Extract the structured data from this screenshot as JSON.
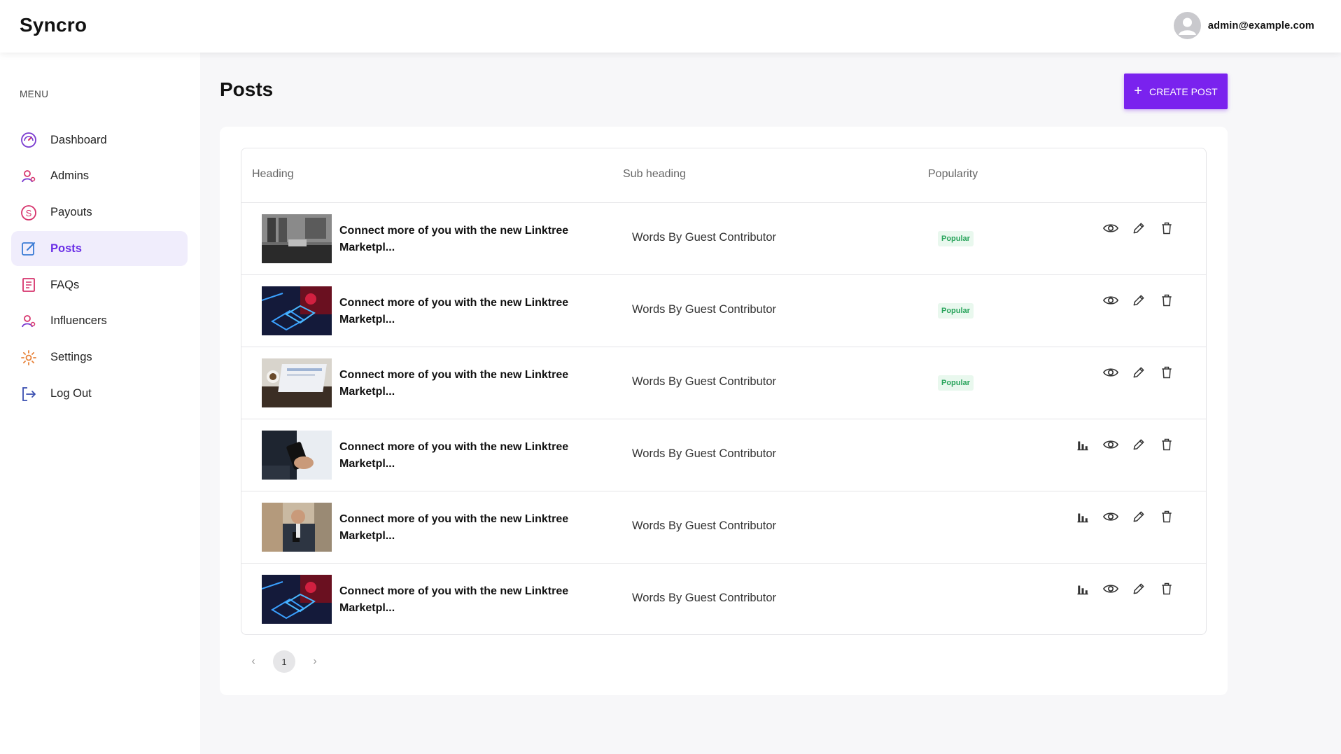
{
  "app": {
    "name": "Syncro"
  },
  "user": {
    "email": "admin@example.com"
  },
  "sidebar": {
    "menu_title": "MENU",
    "items": [
      {
        "label": "Dashboard",
        "icon": "dashboard-icon",
        "active": false
      },
      {
        "label": "Admins",
        "icon": "admins-icon",
        "active": false
      },
      {
        "label": "Payouts",
        "icon": "payouts-icon",
        "active": false
      },
      {
        "label": "Posts",
        "icon": "posts-icon",
        "active": true
      },
      {
        "label": "FAQs",
        "icon": "faqs-icon",
        "active": false
      },
      {
        "label": "Influencers",
        "icon": "influencers-icon",
        "active": false
      },
      {
        "label": "Settings",
        "icon": "settings-icon",
        "active": false
      },
      {
        "label": "Log Out",
        "icon": "logout-icon",
        "active": false
      }
    ]
  },
  "page": {
    "title": "Posts",
    "create_button": "CREATE POST"
  },
  "table": {
    "columns": [
      "Heading",
      "Sub heading",
      "Popularity"
    ],
    "rows": [
      {
        "heading": "Connect more of you with the new Linktree Marketpl...",
        "sub_heading": "Words By Guest Contributor",
        "popularity": "Popular",
        "thumbnail": "office-desk"
      },
      {
        "heading": "Connect more of you with the new Linktree Marketpl...",
        "sub_heading": "Words By Guest Contributor",
        "popularity": "Popular",
        "thumbnail": "neon-gaming"
      },
      {
        "heading": "Connect more of you with the new Linktree Marketpl...",
        "sub_heading": "Words By Guest Contributor",
        "popularity": "Popular",
        "thumbnail": "laptop-coffee"
      },
      {
        "heading": "Connect more of you with the new Linktree Marketpl...",
        "sub_heading": "Words By Guest Contributor",
        "popularity": "",
        "thumbnail": "phone-hands"
      },
      {
        "heading": "Connect more of you with the new Linktree Marketpl...",
        "sub_heading": "Words By Guest Contributor",
        "popularity": "",
        "thumbnail": "man-phone"
      },
      {
        "heading": "Connect more of you with the new Linktree Marketpl...",
        "sub_heading": "Words By Guest Contributor",
        "popularity": "",
        "thumbnail": "neon-gaming"
      }
    ]
  },
  "pagination": {
    "current_page": "1",
    "prev": "‹",
    "next": "›"
  },
  "colors": {
    "accent": "#7a22ee",
    "active_bg": "#f0edfc",
    "badge_bg": "#e9f8ee",
    "badge_text": "#27a35a"
  }
}
